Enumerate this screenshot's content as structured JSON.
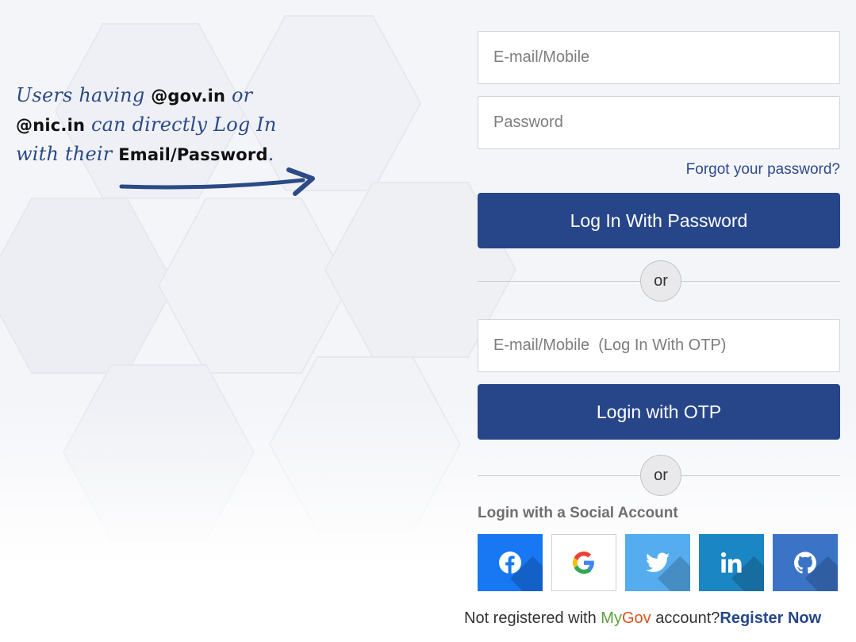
{
  "hint": {
    "line1_a": "Users having ",
    "line1_b": "@gov.in",
    "line1_c": " or",
    "line2_a": "@nic.in",
    "line2_b": " can directly Log In",
    "line3_a": "with their ",
    "line3_b": "Email/Password",
    "line3_c": "."
  },
  "login": {
    "email_placeholder": "E-mail/Mobile",
    "password_placeholder": "Password",
    "forgot_label": "Forgot your password?",
    "password_button": "Log In With Password",
    "or_label": "or",
    "otp_placeholder": "E-mail/Mobile  (Log In With OTP)",
    "otp_button": "Login with OTP"
  },
  "social": {
    "title": "Login with a Social Account",
    "providers": [
      {
        "name": "facebook-icon",
        "bg": "#1877f2"
      },
      {
        "name": "google-icon",
        "bg": "#ffffff"
      },
      {
        "name": "twitter-icon",
        "bg": "#55acee"
      },
      {
        "name": "linkedin-icon",
        "bg": "#1b86c4"
      },
      {
        "name": "github-icon",
        "bg": "#3b73c7"
      }
    ]
  },
  "footer": {
    "prefix": "Not registered with ",
    "brand_my": "My",
    "brand_gov": "Gov",
    "suffix": " account?",
    "register_label": "Register Now"
  },
  "colors": {
    "primary": "#27468a",
    "link": "#2e4a8c",
    "hint_text": "#2b4a86"
  }
}
